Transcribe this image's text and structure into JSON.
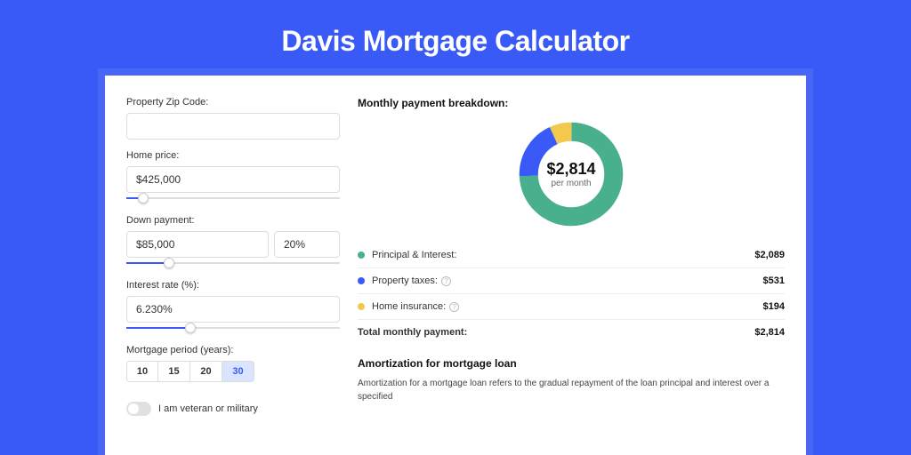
{
  "title": "Davis Mortgage Calculator",
  "left": {
    "zip_label": "Property Zip Code:",
    "zip_value": "",
    "price_label": "Home price:",
    "price_value": "$425,000",
    "price_slider_pct": 8,
    "down_label": "Down payment:",
    "down_value": "$85,000",
    "down_pct": "20%",
    "down_slider_pct": 20,
    "rate_label": "Interest rate (%):",
    "rate_value": "6.230%",
    "rate_slider_pct": 30,
    "period_label": "Mortgage period (years):",
    "periods": [
      "10",
      "15",
      "20",
      "30"
    ],
    "period_active": "30",
    "veteran_label": "I am veteran or military"
  },
  "right": {
    "breakdown_title": "Monthly payment breakdown:",
    "center_value": "$2,814",
    "center_sub": "per month",
    "items": [
      {
        "label": "Principal & Interest:",
        "value": "$2,089",
        "color": "#48b08c",
        "help": false,
        "num": 2089
      },
      {
        "label": "Property taxes:",
        "value": "$531",
        "color": "#3a5af7",
        "help": true,
        "num": 531
      },
      {
        "label": "Home insurance:",
        "value": "$194",
        "color": "#f2c94c",
        "help": true,
        "num": 194
      }
    ],
    "total_label": "Total monthly payment:",
    "total_value": "$2,814",
    "amort_title": "Amortization for mortgage loan",
    "amort_text": "Amortization for a mortgage loan refers to the gradual repayment of the loan principal and interest over a specified"
  },
  "chart_data": {
    "type": "pie",
    "title": "Monthly payment breakdown",
    "categories": [
      "Principal & Interest",
      "Property taxes",
      "Home insurance"
    ],
    "values": [
      2089,
      531,
      194
    ],
    "colors": [
      "#48b08c",
      "#3a5af7",
      "#f2c94c"
    ],
    "center_label": "$2,814 per month"
  }
}
